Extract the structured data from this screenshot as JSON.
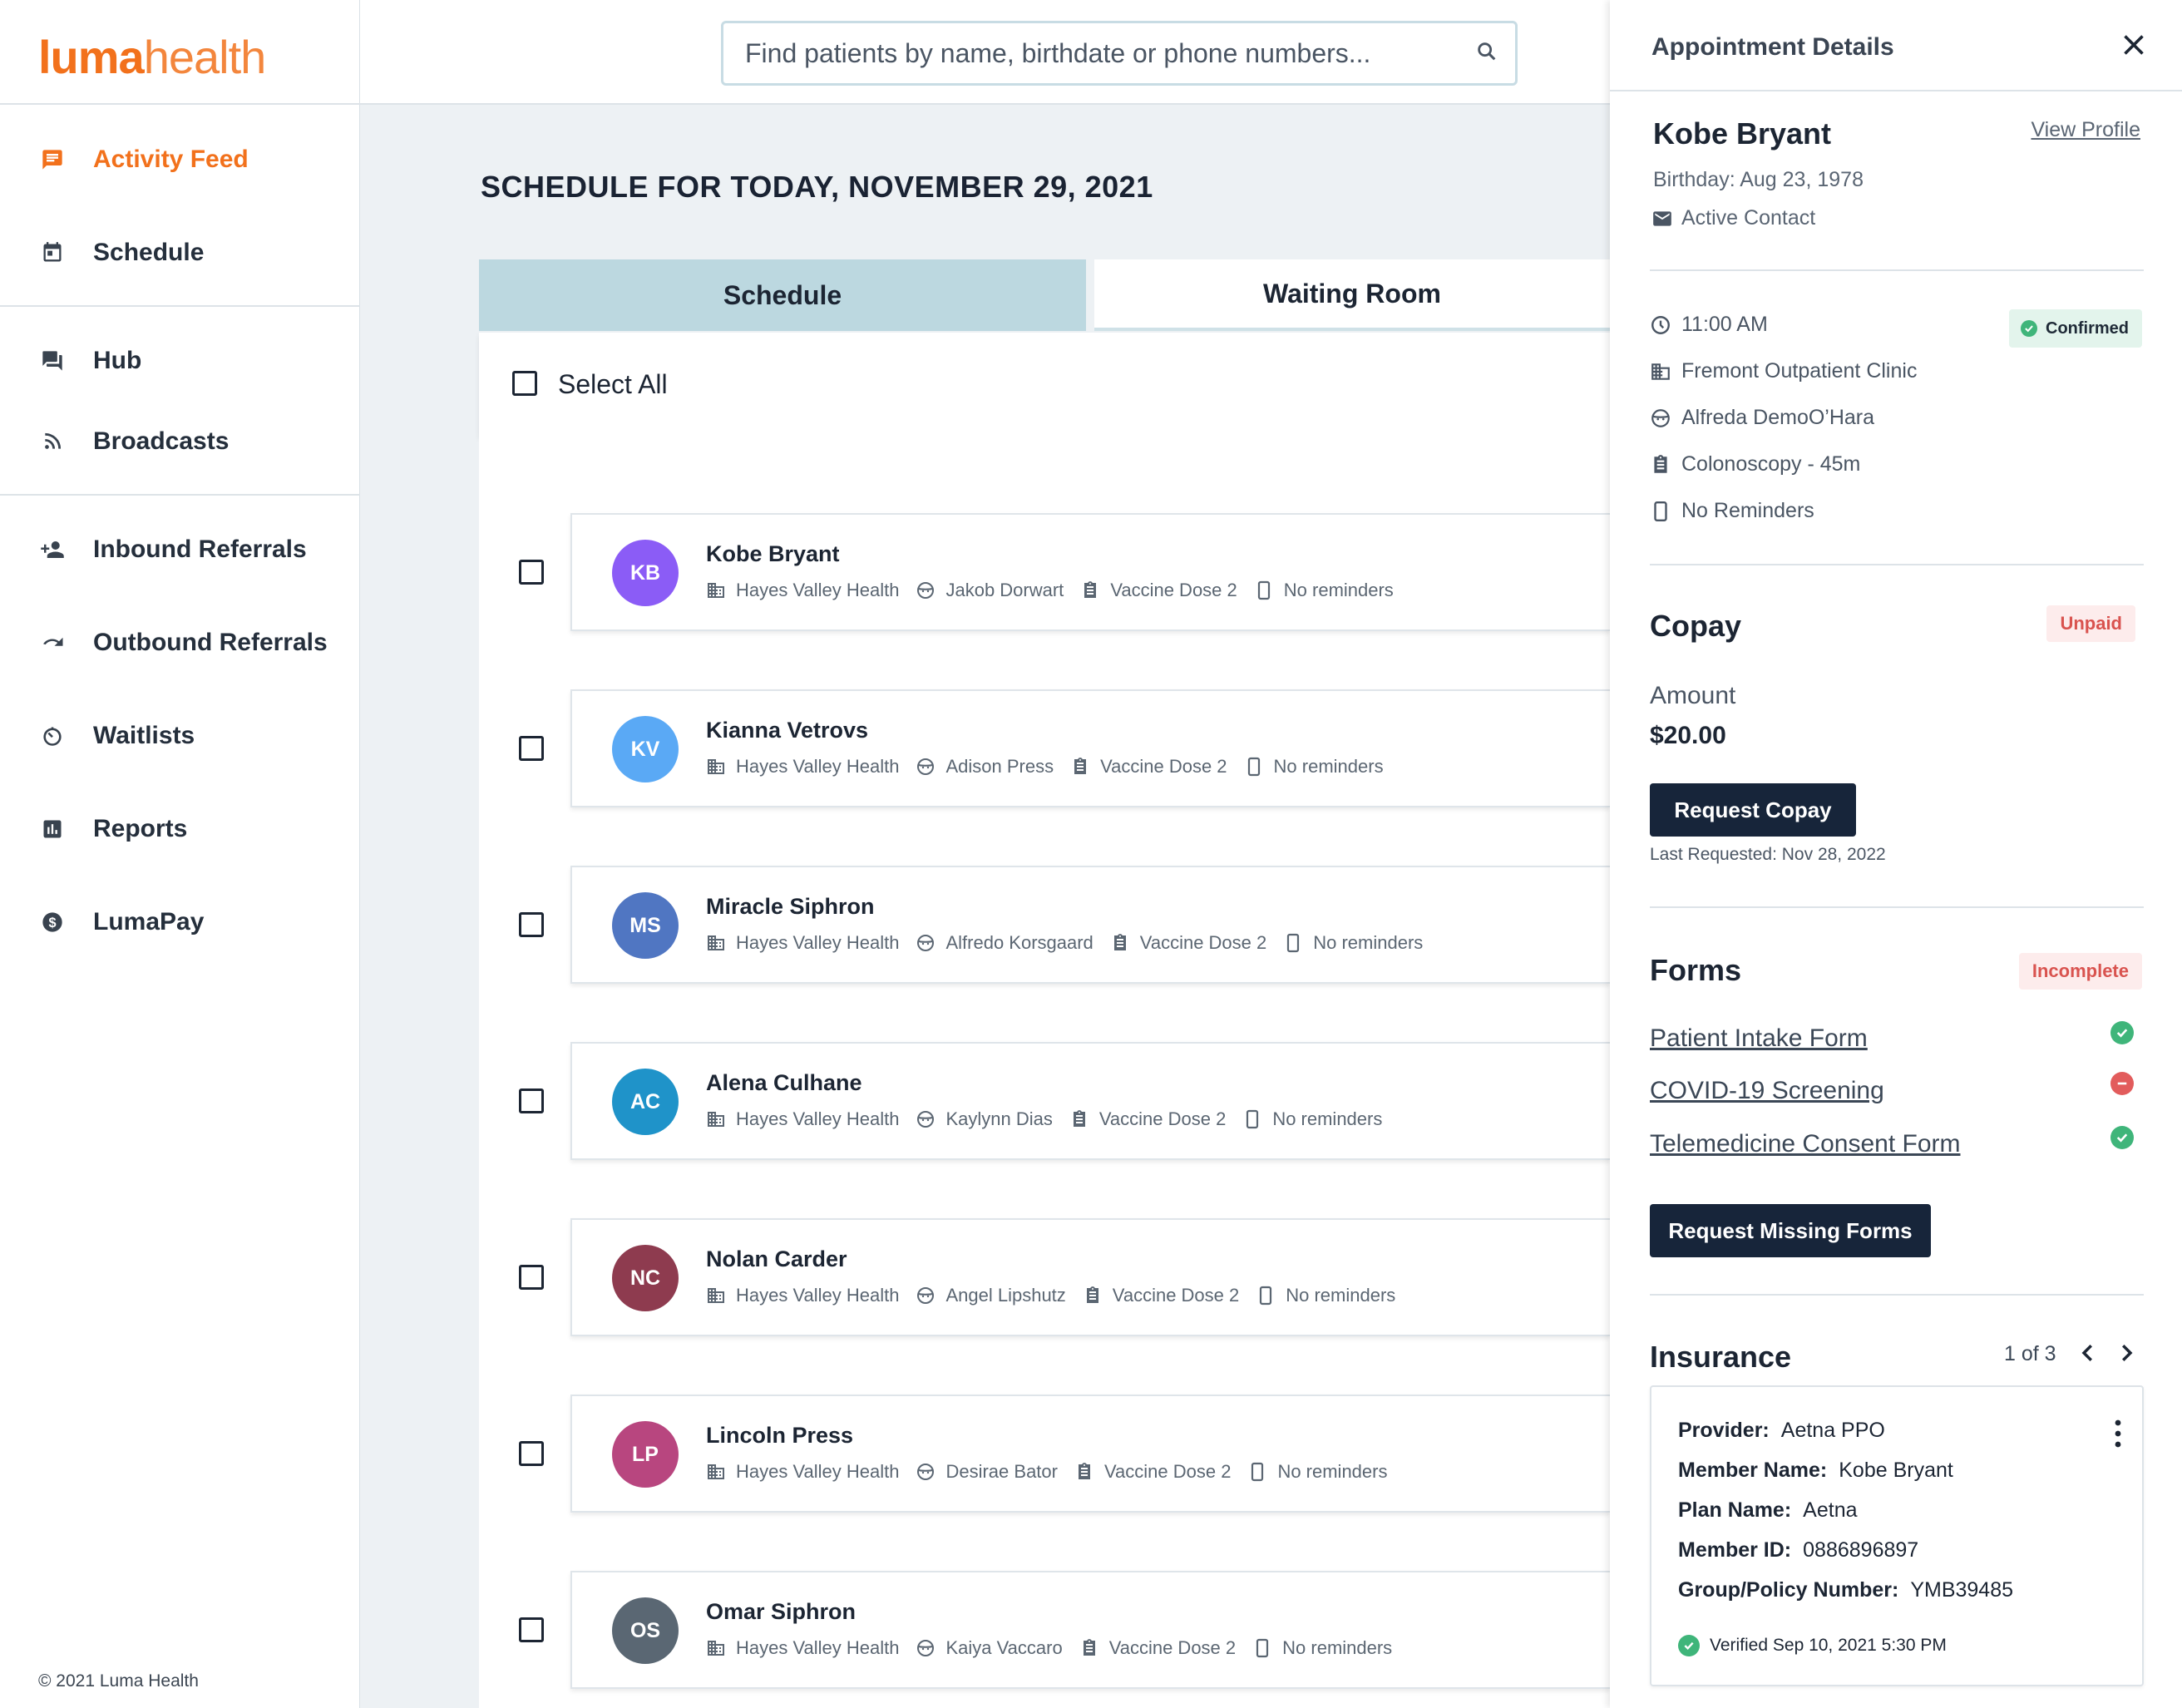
{
  "brand": {
    "logo_bold": "luma",
    "logo_light": "health",
    "accent": "#f2711c"
  },
  "search": {
    "placeholder": "Find patients by name, birthdate or phone numbers..."
  },
  "sidebar": {
    "items": [
      {
        "label": "Activity Feed",
        "icon": "chat-icon"
      },
      {
        "label": "Schedule",
        "icon": "calendar-icon"
      },
      {
        "label": "Hub",
        "icon": "forum-icon"
      },
      {
        "label": "Broadcasts",
        "icon": "rss-icon"
      },
      {
        "label": "Inbound Referrals",
        "icon": "person-add-icon"
      },
      {
        "label": "Outbound Referrals",
        "icon": "redo-icon"
      },
      {
        "label": "Waitlists",
        "icon": "timer-icon"
      },
      {
        "label": "Reports",
        "icon": "bar-chart-icon"
      },
      {
        "label": "LumaPay",
        "icon": "dollar-icon"
      }
    ],
    "copyright": "© 2021 Luma Health"
  },
  "main": {
    "title": "SCHEDULE FOR TODAY, NOVEMBER 29, 2021",
    "tabs": [
      "Schedule",
      "Waiting Room"
    ],
    "select_all": "Select  All",
    "appointments": [
      {
        "initials": "KB",
        "name": "Kobe Bryant",
        "color": "#8b5cf6",
        "location": "Hayes Valley Health",
        "provider": "Jakob Dorwart",
        "type": "Vaccine Dose 2",
        "reminders": "No reminders"
      },
      {
        "initials": "KV",
        "name": "Kianna Vetrovs",
        "color": "#5aa9f5",
        "location": "Hayes Valley Health",
        "provider": "Adison Press",
        "type": "Vaccine Dose 2",
        "reminders": "No reminders"
      },
      {
        "initials": "MS",
        "name": "Miracle Siphron",
        "color": "#5076c2",
        "location": "Hayes Valley Health",
        "provider": "Alfredo Korsgaard",
        "type": "Vaccine Dose 2",
        "reminders": "No reminders"
      },
      {
        "initials": "AC",
        "name": "Alena Culhane",
        "color": "#1f93c9",
        "location": "Hayes Valley Health",
        "provider": "Kaylynn Dias",
        "type": "Vaccine Dose 2",
        "reminders": "No reminders"
      },
      {
        "initials": "NC",
        "name": "Nolan Carder",
        "color": "#8e3b4f",
        "location": "Hayes Valley Health",
        "provider": "Angel Lipshutz",
        "type": "Vaccine Dose 2",
        "reminders": "No reminders"
      },
      {
        "initials": "LP",
        "name": "Lincoln Press",
        "color": "#b8467f",
        "location": "Hayes Valley Health",
        "provider": "Desirae Bator",
        "type": "Vaccine Dose 2",
        "reminders": "No reminders"
      },
      {
        "initials": "OS",
        "name": "Omar Siphron",
        "color": "#5a6773",
        "location": "Hayes Valley Health",
        "provider": "Kaiya Vaccaro",
        "type": "Vaccine Dose 2",
        "reminders": "No reminders"
      }
    ]
  },
  "panel": {
    "title": "Appointment Details",
    "patient": {
      "name": "Kobe Bryant",
      "view_profile": "View Profile",
      "birthday": "Birthday: Aug 23, 1978",
      "contact": "Active Contact"
    },
    "details": {
      "time": "11:00 AM",
      "status": "Confirmed",
      "clinic": "Fremont Outpatient Clinic",
      "provider": "Alfreda DemoO’Hara",
      "procedure": "Colonoscopy - 45m",
      "reminders": "No Reminders"
    },
    "copay": {
      "title": "Copay",
      "status": "Unpaid",
      "amount_label": "Amount",
      "amount": "$20.00",
      "button": "Request Copay",
      "last_requested": "Last Requested: Nov 28, 2022"
    },
    "forms": {
      "title": "Forms",
      "status": "Incomplete",
      "items": [
        {
          "name": "Patient Intake Form",
          "state": "complete"
        },
        {
          "name": "COVID-19 Screening",
          "state": "missing"
        },
        {
          "name": "Telemedicine Consent Form",
          "state": "complete"
        }
      ],
      "button": "Request Missing Forms"
    },
    "insurance": {
      "title": "Insurance",
      "count": "1 of 3",
      "provider_k": "Provider:",
      "provider": "Aetna PPO",
      "member_name_k": "Member Name:",
      "member_name": "Kobe Bryant",
      "plan_k": "Plan Name:",
      "plan": "Aetna",
      "member_id_k": "Member ID:",
      "member_id": "0886896897",
      "group_k": "Group/Policy Number:",
      "group": "YMB39485",
      "verified": "Verified Sep 10, 2021 5:30 PM"
    }
  }
}
